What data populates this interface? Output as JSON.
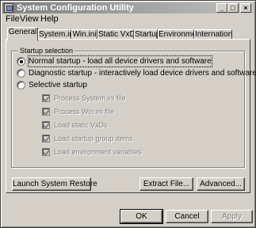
{
  "window": {
    "title": "System Configuration Utility",
    "controls": {
      "minimize": "_",
      "maximize": "□",
      "close": "×"
    }
  },
  "menu": [
    {
      "label": "File"
    },
    {
      "label": "View"
    },
    {
      "label": "Help"
    }
  ],
  "tabs": [
    {
      "label": "General",
      "active": true
    },
    {
      "label": "System.ini"
    },
    {
      "label": "Win.ini"
    },
    {
      "label": "Static VxDs"
    },
    {
      "label": "Startup"
    },
    {
      "label": "Environment"
    },
    {
      "label": "International"
    }
  ],
  "general": {
    "group_title": "Startup selection",
    "options": [
      {
        "label": "Normal startup - load all device drivers and software",
        "selected": true
      },
      {
        "label": "Diagnostic startup - interactively load device drivers and software",
        "selected": false
      },
      {
        "label": "Selective startup",
        "selected": false
      }
    ],
    "selective_items": [
      {
        "label": "Process System.ini file",
        "checked": true,
        "enabled": false
      },
      {
        "label": "Process Win.ini file",
        "checked": true,
        "enabled": false
      },
      {
        "label": "Load static VxDs",
        "checked": true,
        "enabled": false
      },
      {
        "label": "Load startup group items",
        "checked": true,
        "enabled": false
      },
      {
        "label": "Load environment variables",
        "checked": true,
        "enabled": false
      }
    ],
    "buttons": {
      "launch_restore": "Launch System Restore",
      "extract_file": "Extract File...",
      "advanced": "Advanced..."
    }
  },
  "dialog_buttons": {
    "ok": "OK",
    "cancel": "Cancel",
    "apply": "Apply"
  }
}
